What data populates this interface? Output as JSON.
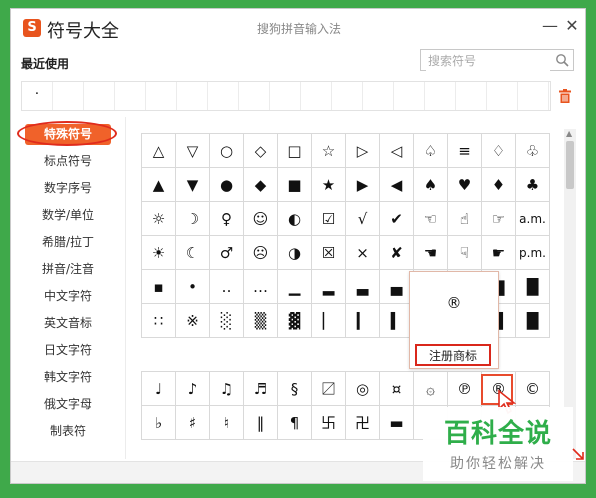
{
  "window": {
    "app_title": "符号大全",
    "logo_glyph": "S",
    "ime_name": "搜狗拼音输入法",
    "min_glyph": "—",
    "close_glyph": "✕"
  },
  "recent": {
    "label": "最近使用",
    "items": [
      "·",
      "",
      "",
      "",
      "",
      "",
      "",
      "",
      "",
      "",
      "",
      "",
      "",
      "",
      "",
      "",
      ""
    ]
  },
  "search": {
    "placeholder": "搜索符号"
  },
  "categories": [
    "特殊符号",
    "标点符号",
    "数字序号",
    "数学/单位",
    "希腊/拉丁",
    "拼音/注音",
    "中文字符",
    "英文音标",
    "日文字符",
    "韩文字符",
    "俄文字母",
    "制表符"
  ],
  "active_category": "特殊符号",
  "grid1": [
    [
      "△",
      "▽",
      "○",
      "◇",
      "□",
      "☆",
      "▷",
      "◁",
      "♤",
      "≡",
      "♢",
      "♧"
    ],
    [
      "▲",
      "▼",
      "●",
      "◆",
      "■",
      "★",
      "▶",
      "◀",
      "♠",
      "♥",
      "♦",
      "♣"
    ],
    [
      "☼",
      "☽",
      "♀",
      "☺",
      "◐",
      "☑",
      "√",
      "✔",
      "☜",
      "☝",
      "☞",
      "a.m."
    ],
    [
      "☀",
      "☾",
      "♂",
      "☹",
      "◑",
      "☒",
      "×",
      "✘",
      "☚",
      "☟",
      "☛",
      "p.m."
    ],
    [
      "▪",
      "•",
      "‥",
      "…",
      "▁",
      "▂",
      "▃",
      "▄",
      "",
      "",
      "▇",
      "█"
    ],
    [
      "∷",
      "※",
      "░",
      "▒",
      "▓",
      "▏",
      "▎",
      "▍",
      "",
      "",
      "▉",
      "█"
    ]
  ],
  "grid2": [
    [
      "♩",
      "♪",
      "♫",
      "♬",
      "§",
      "〼",
      "◎",
      "¤",
      "۞",
      "℗",
      "®",
      "©"
    ],
    [
      "♭",
      "♯",
      "♮",
      "‖",
      "¶",
      "卐",
      "卍",
      "▬",
      "",
      "",
      "",
      ""
    ]
  ],
  "popup": {
    "glyph": "®",
    "label": "注册商标"
  },
  "watermark": {
    "title": "百科全说",
    "subtitle": "助你轻松解决"
  },
  "colors": {
    "accent": "#f0622a",
    "highlight": "#d9271b",
    "watermark": "#2fae4a",
    "desktop": "#3fa94a"
  }
}
